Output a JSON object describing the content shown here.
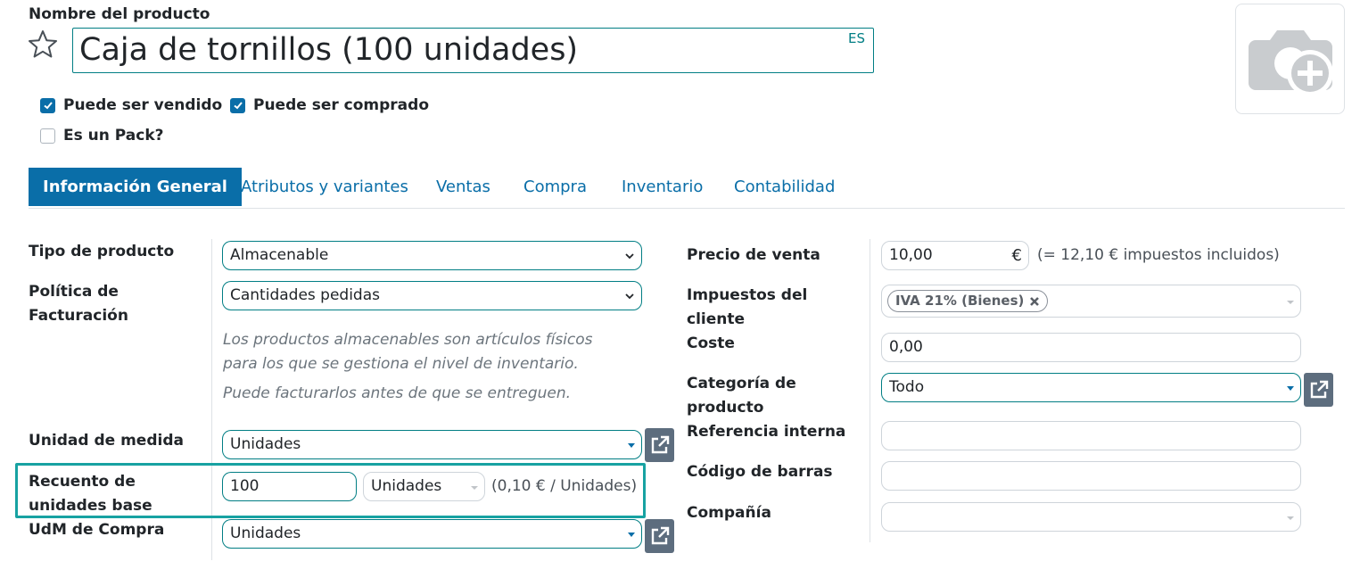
{
  "header": {
    "product_label": "Nombre del producto",
    "product_name": "Caja de tornillos (100 unidades)",
    "lang_badge": "ES",
    "favorite_icon": "star-outline-icon",
    "photo_icon": "camera-plus-icon"
  },
  "options": {
    "can_be_sold": {
      "label": "Puede ser vendido",
      "checked": true
    },
    "can_be_purchased": {
      "label": "Puede ser comprado",
      "checked": true
    },
    "is_pack": {
      "label": "Es un Pack?",
      "checked": false
    }
  },
  "tabs": [
    {
      "label": "Información General",
      "active": true
    },
    {
      "label": "Atributos y variantes",
      "active": false
    },
    {
      "label": "Ventas",
      "active": false
    },
    {
      "label": "Compra",
      "active": false
    },
    {
      "label": "Inventario",
      "active": false
    },
    {
      "label": "Contabilidad",
      "active": false
    }
  ],
  "left": {
    "product_type": {
      "label": "Tipo de producto",
      "value": "Almacenable"
    },
    "invoicing_policy": {
      "label_line1": "Política de",
      "label_line2": "Facturación",
      "value": "Cantidades pedidas"
    },
    "help_line1": "Los productos almacenables son artículos físicos",
    "help_line2": "para los que se gestiona el nivel de inventario.",
    "help_line3": "Puede facturarlos antes de que se entreguen.",
    "uom": {
      "label": "Unidad de medida",
      "value": "Unidades"
    },
    "base_unit_count": {
      "label_line1": "Recuento de",
      "label_line2": "unidades base",
      "value": "100",
      "unit": "Unidades",
      "unit_price": "(0,10 € / Unidades)"
    },
    "purchase_uom": {
      "label": "UdM de Compra",
      "value": "Unidades"
    }
  },
  "right": {
    "sale_price": {
      "label": "Precio de venta",
      "value": "10,00",
      "currency": "€",
      "tax_included": "(= 12,10 € impuestos incluidos)"
    },
    "customer_taxes": {
      "label_line1": "Impuestos del",
      "label_line2": "cliente",
      "tag": "IVA 21% (Bienes)"
    },
    "cost": {
      "label": "Coste",
      "value": "0,00"
    },
    "category": {
      "label_line1": "Categoría de",
      "label_line2": "producto",
      "value": "Todo"
    },
    "internal_ref": {
      "label": "Referencia interna",
      "value": ""
    },
    "barcode": {
      "label": "Código de barras",
      "value": ""
    },
    "company": {
      "label": "Compañía",
      "value": ""
    }
  },
  "colors": {
    "primary": "#0a6ea8",
    "accent_teal": "#017e84",
    "highlight": "#17a2a2",
    "external_button": "#5d6d7e"
  }
}
